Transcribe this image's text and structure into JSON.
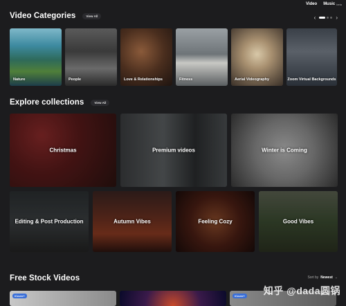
{
  "topnav": {
    "video": "Video",
    "music": "Music",
    "beta": "beta"
  },
  "categories": {
    "title": "Video Categories",
    "view_all": "View All",
    "prev": "‹",
    "next": "›",
    "items": [
      {
        "label": "Nature"
      },
      {
        "label": "People"
      },
      {
        "label": "Love & Relationships"
      },
      {
        "label": "Fitness"
      },
      {
        "label": "Aerial Videography"
      },
      {
        "label": "Zoom Virtual Backgrounds"
      }
    ]
  },
  "collections": {
    "title": "Explore collections",
    "view_all": "View All",
    "items": [
      {
        "label": "Christmas"
      },
      {
        "label": "Premium videos"
      },
      {
        "label": "Winter is Coming"
      },
      {
        "label": "Editing & Post Production"
      },
      {
        "label": "Autumn Vibes"
      },
      {
        "label": "Feeling Cozy"
      },
      {
        "label": "Good Vibes"
      }
    ]
  },
  "stock": {
    "title": "Free Stock Videos",
    "sort_label": "Sort by",
    "sort_value": "Newest",
    "badge1": "iCover+",
    "badge2": "iCover+"
  },
  "watermark": "知乎 @dada圆锅"
}
